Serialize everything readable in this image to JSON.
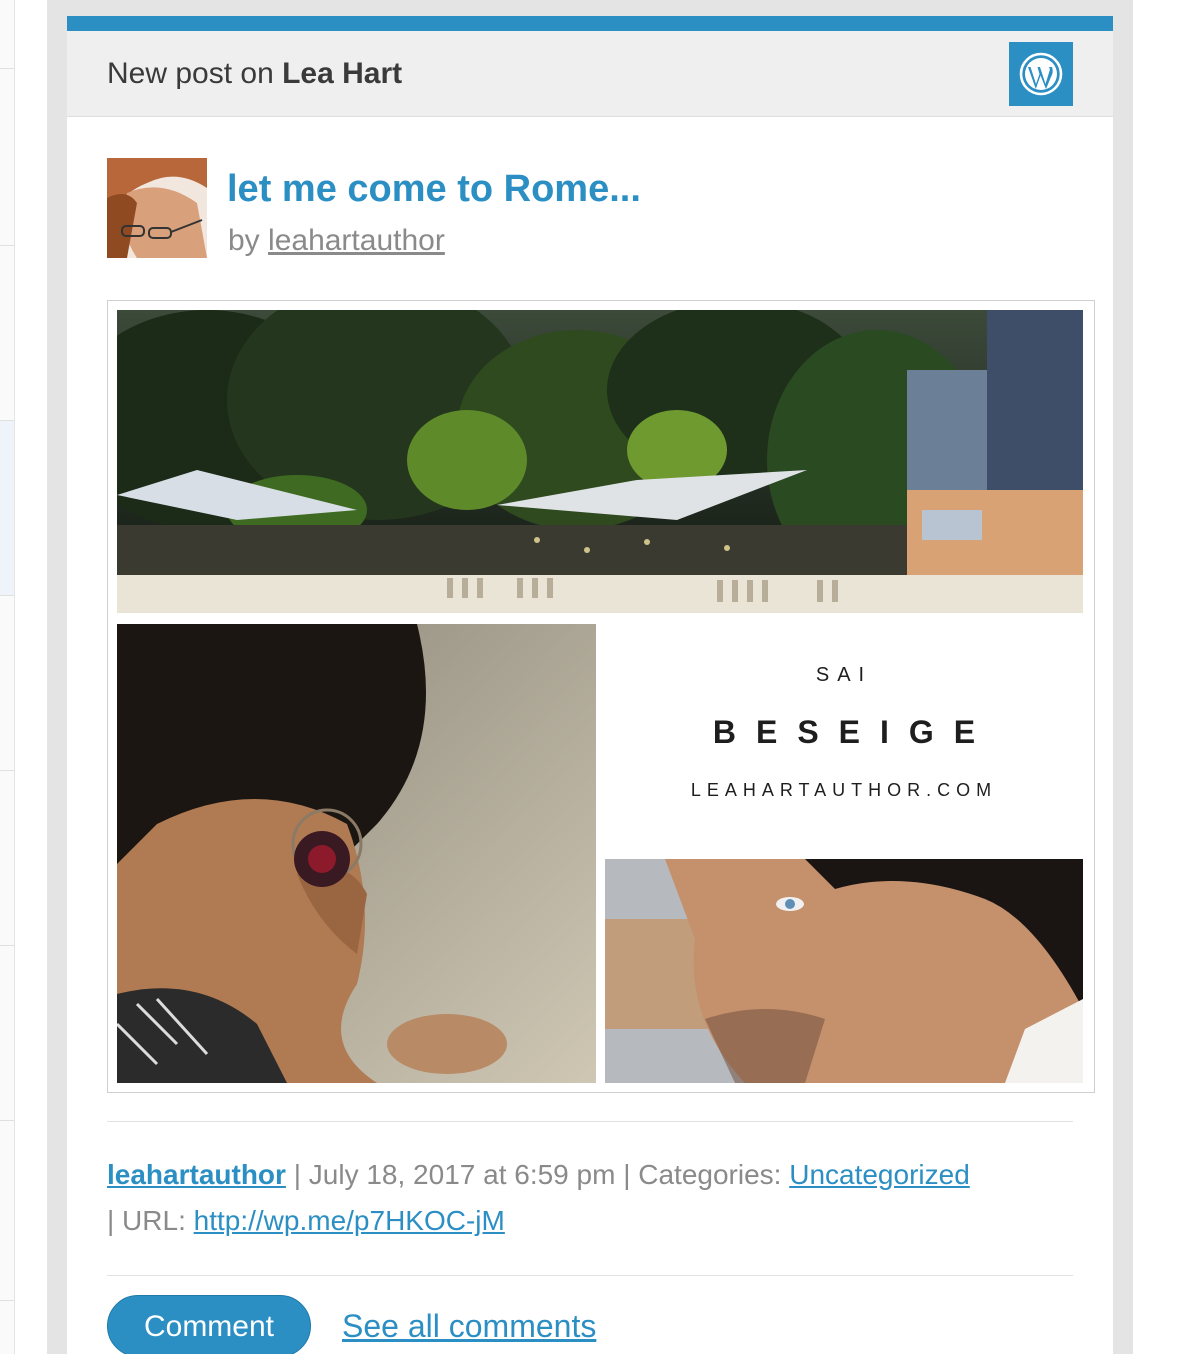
{
  "header": {
    "prefix": "New post on",
    "site_name": "Lea Hart",
    "logo_icon": "wordpress-icon"
  },
  "post": {
    "title": "let me come to Rome...",
    "by_label": "by",
    "author": "leahartauthor"
  },
  "collage": {
    "line1": "SAI",
    "line2": "BESEIGE",
    "line3": "LEAHARTAUTHOR.COM"
  },
  "meta": {
    "author": "leahartauthor",
    "date": "| July 18, 2017 at 6:59 pm | Categories:",
    "category": "Uncategorized",
    "url_label": "| URL:",
    "url": "http://wp.me/p7HKOC-jM"
  },
  "actions": {
    "comment": "Comment",
    "see_all": "See all comments"
  },
  "colors": {
    "accent": "#2c8fc4",
    "header_bg": "#efefef",
    "muted_text": "#8a8a8a"
  }
}
